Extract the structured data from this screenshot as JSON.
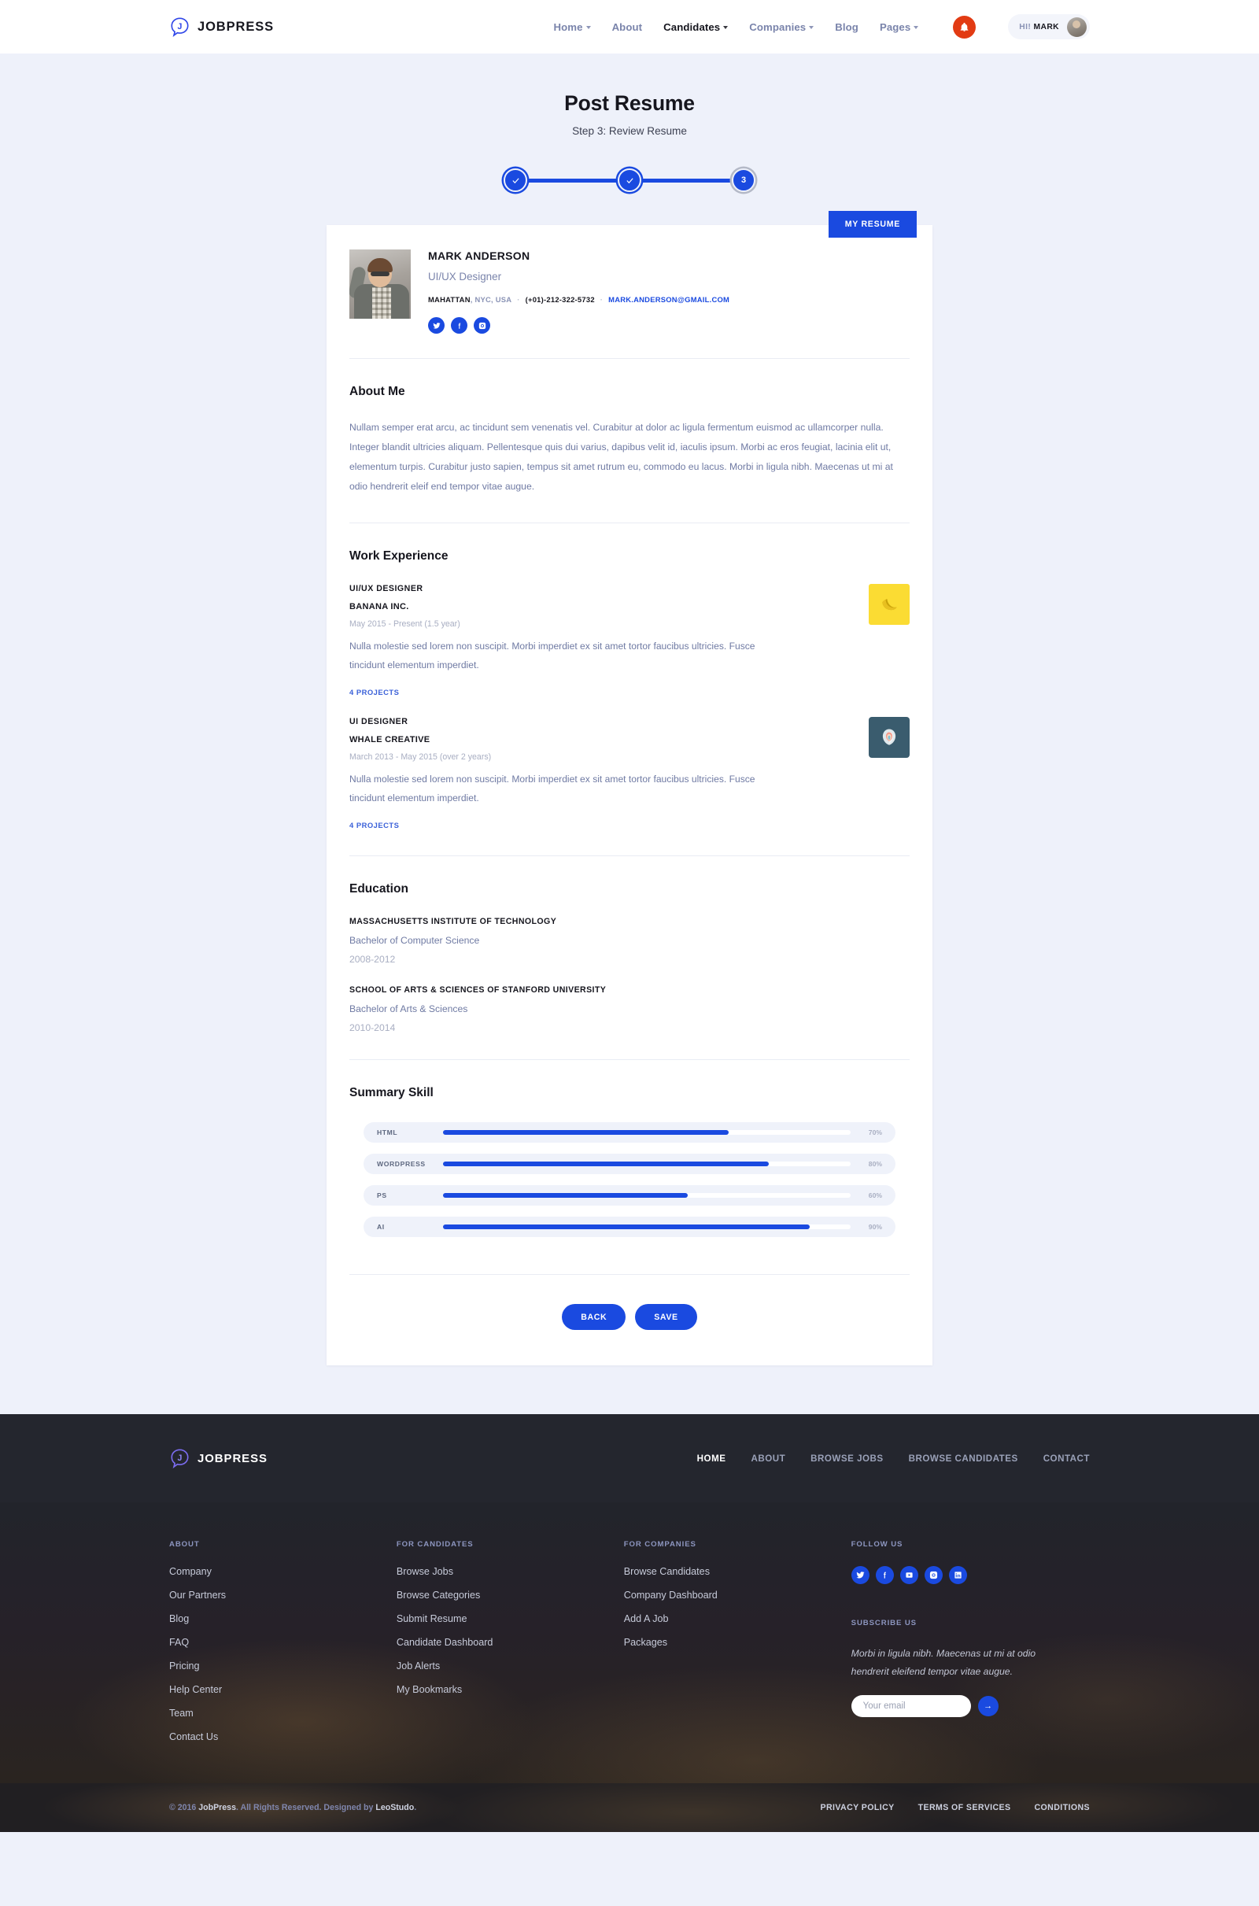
{
  "brand": {
    "name": "JOBPRESS"
  },
  "header": {
    "nav": [
      {
        "label": "Home",
        "caret": true,
        "active": false
      },
      {
        "label": "About",
        "caret": false,
        "active": false
      },
      {
        "label": "Candidates",
        "caret": true,
        "active": true
      },
      {
        "label": "Companies",
        "caret": true,
        "active": false
      },
      {
        "label": "Blog",
        "caret": false,
        "active": false
      },
      {
        "label": "Pages",
        "caret": true,
        "active": false
      }
    ],
    "greeting_hi": "HI!",
    "greeting_name": "MARK"
  },
  "page": {
    "title": "Post Resume",
    "subtitle": "Step 3: Review Resume"
  },
  "stepper": {
    "steps": [
      {
        "label": "1",
        "state": "done"
      },
      {
        "label": "2",
        "state": "done"
      },
      {
        "label": "3",
        "state": "current"
      }
    ]
  },
  "resume": {
    "my_resume_label": "MY RESUME",
    "profile": {
      "name": "MARK ANDERSON",
      "role": "UI/UX Designer",
      "city": "MAHATTAN",
      "location_rest": ", NYC, USA",
      "phone": "(+01)-212-322-5732",
      "email": "MARK.ANDERSON@GMAIL.COM",
      "socials": [
        "twitter-icon",
        "facebook-icon",
        "instagram-icon"
      ]
    },
    "about": {
      "heading": "About Me",
      "body": "Nullam semper erat arcu, ac tincidunt sem venenatis vel. Curabitur at dolor ac ligula fermentum euismod ac ullamcorper nulla. Integer blandit ultricies aliquam. Pellentesque quis dui varius, dapibus velit id, iaculis ipsum. Morbi ac eros feugiat, lacinia elit ut, elementum turpis. Curabitur justo sapien, tempus sit amet rutrum eu, commodo eu lacus. Morbi in ligula nibh. Maecenas ut mi at odio hendrerit eleif end tempor vitae augue."
    },
    "work": {
      "heading": "Work Experience",
      "jobs": [
        {
          "title": "UI/UX DESIGNER",
          "company": "BANANA INC.",
          "dates": "May 2015 - Present (1.5 year)",
          "description": "Nulla molestie sed lorem non suscipit. Morbi imperdiet ex sit amet tortor faucibus ultricies. Fusce tincidunt elementum imperdiet.",
          "projects": "4 PROJECTS",
          "logo": "banana-logo"
        },
        {
          "title": "UI DESIGNER",
          "company": "WHALE CREATIVE",
          "dates": "March 2013 - May 2015 (over 2 years)",
          "description": "Nulla molestie sed lorem non suscipit. Morbi imperdiet ex sit amet tortor faucibus ultricies. Fusce tincidunt elementum imperdiet.",
          "projects": "4 PROJECTS",
          "logo": "whale-logo"
        }
      ]
    },
    "education": {
      "heading": "Education",
      "items": [
        {
          "school": "MASSACHUSETTS INSTITUTE OF TECHNOLOGY",
          "degree": "Bachelor of Computer Science",
          "years": "2008-2012"
        },
        {
          "school": "SCHOOL OF ARTS & SCIENCES OF STANFORD UNIVERSITY",
          "degree": "Bachelor of Arts & Sciences",
          "years": "2010-2014"
        }
      ]
    },
    "skills": {
      "heading": "Summary Skill",
      "items": [
        {
          "name": "HTML",
          "percent_label": "70%",
          "percent": 70
        },
        {
          "name": "WORDPRESS",
          "percent_label": "80%",
          "percent": 80
        },
        {
          "name": "PS",
          "percent_label": "60%",
          "percent": 60
        },
        {
          "name": "AI",
          "percent_label": "90%",
          "percent": 90
        }
      ]
    },
    "actions": {
      "back": "BACK",
      "save": "SAVE"
    }
  },
  "footer": {
    "nav": [
      {
        "label": "HOME",
        "active": true
      },
      {
        "label": "ABOUT",
        "active": false
      },
      {
        "label": "BROWSE JOBS",
        "active": false
      },
      {
        "label": "BROWSE CANDIDATES",
        "active": false
      },
      {
        "label": "CONTACT",
        "active": false
      }
    ],
    "columns": [
      {
        "heading": "ABOUT",
        "links": [
          "Company",
          "Our Partners",
          "Blog",
          "FAQ",
          "Pricing",
          "Help Center",
          "Team",
          "Contact Us"
        ]
      },
      {
        "heading": "FOR CANDIDATES",
        "links": [
          "Browse Jobs",
          "Browse Categories",
          "Submit Resume",
          "Candidate Dashboard",
          "Job Alerts",
          "My Bookmarks"
        ]
      },
      {
        "heading": "FOR COMPANIES",
        "links": [
          "Browse Candidates",
          "Company Dashboard",
          "Add A Job",
          "Packages"
        ]
      }
    ],
    "follow": {
      "heading": "FOLLOW US",
      "icons": [
        "twitter-icon",
        "facebook-icon",
        "youtube-icon",
        "instagram-icon",
        "linkedin-icon"
      ]
    },
    "subscribe": {
      "heading": "SUBSCRIBE US",
      "text": "Morbi in ligula nibh. Maecenas ut mi at odio hendrerit eleifend tempor vitae augue.",
      "placeholder": "Your email",
      "submit": "→"
    },
    "copyright_pre": "© 2016 ",
    "copyright_brand": "JobPress",
    "copyright_mid": ". All Rights Reserved. Designed by ",
    "copyright_author": "LeoStudo",
    "copyright_end": ".",
    "legal": [
      "PRIVACY POLICY",
      "TERMS OF SERVICES",
      "CONDITIONS"
    ]
  },
  "colors": {
    "accent": "#1a4ae0",
    "alert": "#e23b13",
    "page_bg": "#eef1fa"
  }
}
